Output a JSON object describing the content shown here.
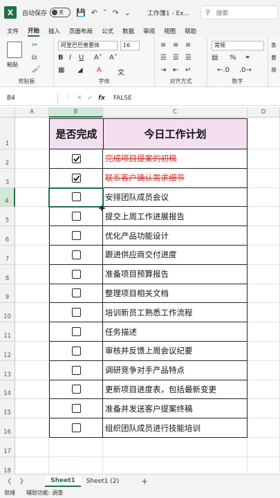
{
  "titlebar": {
    "autosave_label": "自动保存",
    "autosave_state": "关",
    "doc_title": "工作簿1 - Ex...",
    "search_placeholder": "搜索"
  },
  "tabs": [
    "文件",
    "开始",
    "插入",
    "页面布局",
    "公式",
    "数据",
    "审阅",
    "视图",
    "帮助"
  ],
  "active_tab": "开始",
  "ribbon": {
    "paste_label": "粘贴",
    "clipboard_label": "剪贴板",
    "font_name": "阿里巴巴普惠体",
    "font_size": "16",
    "font_label": "字体",
    "align_label": "对齐方式",
    "number_format": "常规",
    "number_label": "数字",
    "currency_symbol": "%",
    "cond_format": "条",
    "table_format": "套",
    "cell_style": "单"
  },
  "formula_bar": {
    "cell_ref": "B4",
    "fx": "fx",
    "value": "FALSE"
  },
  "columns": [
    "A",
    "B",
    "C",
    "D"
  ],
  "rows": [
    "1",
    "2",
    "3",
    "4",
    "5",
    "6",
    "7",
    "8",
    "9",
    "10",
    "11",
    "12",
    "13",
    "14",
    "15",
    "16",
    "17",
    "18",
    "19"
  ],
  "table": {
    "header_b": "是否完成",
    "header_c": "今日工作计划",
    "tasks": [
      {
        "done": true,
        "text": "完成项目提案的初稿"
      },
      {
        "done": true,
        "text": "联系客户确认需求细节"
      },
      {
        "done": false,
        "text": "安排团队成员会议"
      },
      {
        "done": false,
        "text": "提交上周工作进展报告"
      },
      {
        "done": false,
        "text": "优化产品功能设计"
      },
      {
        "done": false,
        "text": "跟进供应商交付进度"
      },
      {
        "done": false,
        "text": "准备项目预算报告"
      },
      {
        "done": false,
        "text": "整理项目相关文档"
      },
      {
        "done": false,
        "text": "培训新员工熟悉工作流程"
      },
      {
        "done": false,
        "text": "任务描述"
      },
      {
        "done": false,
        "text": "审核并反馈上周会议纪要"
      },
      {
        "done": false,
        "text": "调研竞争对手产品特点"
      },
      {
        "done": false,
        "text": "更新项目进度表，包括最新变更"
      },
      {
        "done": false,
        "text": "准备并发送客户提案终稿"
      },
      {
        "done": false,
        "text": "组织团队成员进行技能培训"
      }
    ]
  },
  "sheet_tabs": [
    "Sheet1",
    "Sheet1 (2)"
  ],
  "active_sheet": "Sheet1",
  "status": {
    "ready": "就绪",
    "accessibility": "辅助功能: 调查"
  }
}
